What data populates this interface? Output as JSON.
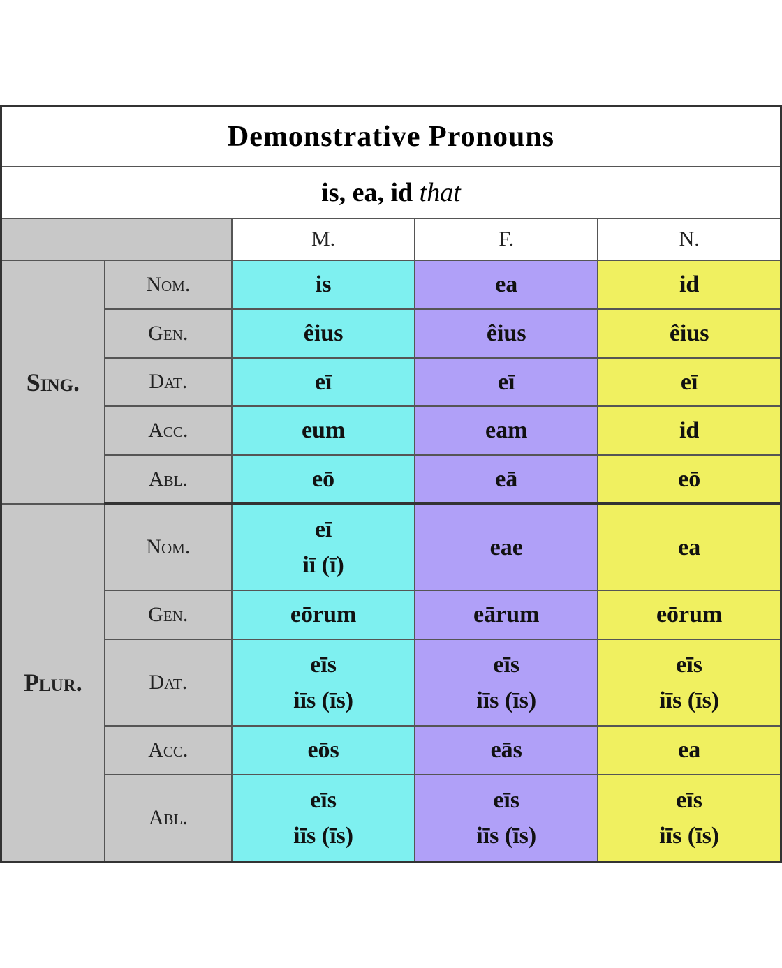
{
  "title": "Demonstrative Pronouns",
  "subtitle_plain": "is, ea, id ",
  "subtitle_italic": "that",
  "header": {
    "m": "M.",
    "f": "F.",
    "n": "N."
  },
  "sing_label": "Sing.",
  "plur_label": "Plur.",
  "rows": {
    "sing": [
      {
        "case": "Nom.",
        "m": "is",
        "f": "ea",
        "n": "id"
      },
      {
        "case": "Gen.",
        "m": "êius",
        "f": "êius",
        "n": "êius"
      },
      {
        "case": "Dat.",
        "m": "eī",
        "f": "eī",
        "n": "eī"
      },
      {
        "case": "Acc.",
        "m": "eum",
        "f": "eam",
        "n": "id"
      },
      {
        "case": "Abl.",
        "m": "eō",
        "f": "eā",
        "n": "eō"
      }
    ],
    "plur": [
      {
        "case": "Nom.",
        "m": "eī\niī (ī)",
        "f": "eae",
        "n": "ea"
      },
      {
        "case": "Gen.",
        "m": "eōrum",
        "f": "eārum",
        "n": "eōrum"
      },
      {
        "case": "Dat.",
        "m": "eīs\niīs (īs)",
        "f": "eīs\niīs (īs)",
        "n": "eīs\niīs (īs)"
      },
      {
        "case": "Acc.",
        "m": "eōs",
        "f": "eās",
        "n": "ea"
      },
      {
        "case": "Abl.",
        "m": "eīs\niīs (īs)",
        "f": "eīs\niīs (īs)",
        "n": "eīs\niīs (īs)"
      }
    ]
  }
}
